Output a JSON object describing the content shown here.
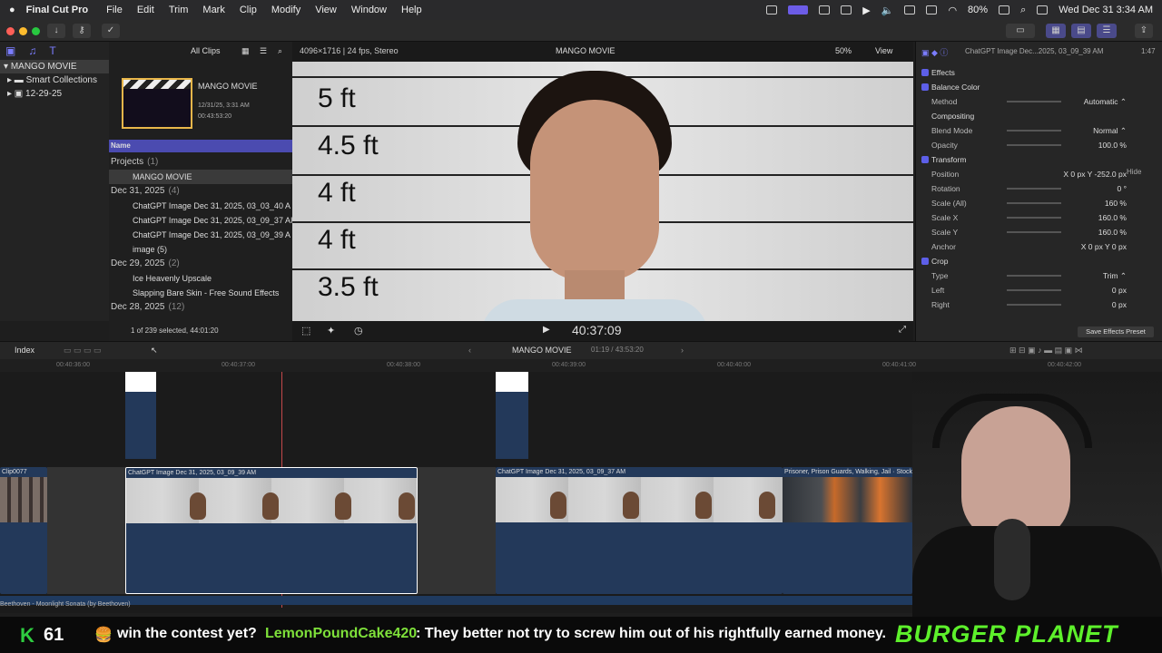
{
  "menubar": {
    "app": "Final Cut Pro",
    "items": [
      "File",
      "Edit",
      "Trim",
      "Mark",
      "Clip",
      "Modify",
      "View",
      "Window",
      "Help"
    ],
    "battery": "80%",
    "datetime": "Wed Dec 31  3:34 AM"
  },
  "library": {
    "name": "MANGO MOVIE",
    "items": [
      "Smart Collections",
      "12-29-25"
    ]
  },
  "browser": {
    "filter": "All Clips",
    "project_name": "MANGO MOVIE",
    "project_date": "12/31/25, 3:31 AM",
    "project_duration": "00:43:53:20",
    "column": "Name",
    "status": "1 of 239 selected, 44:01:20",
    "rows": [
      {
        "t": "Projects",
        "c": "(1)",
        "kind": "group"
      },
      {
        "t": "MANGO MOVIE",
        "c": "",
        "kind": "sel"
      },
      {
        "t": "Dec 31, 2025",
        "c": "(4)",
        "kind": "group"
      },
      {
        "t": "ChatGPT Image Dec 31, 2025, 03_03_40 A",
        "c": "",
        "kind": "item"
      },
      {
        "t": "ChatGPT Image Dec 31, 2025, 03_09_37 AI",
        "c": "",
        "kind": "item"
      },
      {
        "t": "ChatGPT Image Dec 31, 2025, 03_09_39 A",
        "c": "",
        "kind": "item"
      },
      {
        "t": "image (5)",
        "c": "",
        "kind": "item"
      },
      {
        "t": "Dec 29, 2025",
        "c": "(2)",
        "kind": "group"
      },
      {
        "t": "Ice Heavenly Upscale",
        "c": "",
        "kind": "item"
      },
      {
        "t": "Slapping Bare Skin - Free Sound Effects",
        "c": "",
        "kind": "item"
      },
      {
        "t": "Dec 28, 2025",
        "c": "(12)",
        "kind": "group"
      }
    ]
  },
  "viewer": {
    "format": "4096×1716 | 24 fps, Stereo",
    "title": "MANGO MOVIE",
    "zoom": "50%",
    "view": "View",
    "timecode": "40:37:09",
    "heights": [
      "5 ft",
      "4.5 ft",
      "4 ft",
      "4 ft",
      "3.5 ft"
    ]
  },
  "inspector": {
    "clip": "ChatGPT Image Dec...2025, 03_09_39 AM",
    "duration": "1:47",
    "rows": [
      {
        "l": "Effects",
        "v": "",
        "kind": "sec"
      },
      {
        "l": "Balance Color",
        "v": "",
        "kind": "chk"
      },
      {
        "l": "Method",
        "v": "Automatic ⌃",
        "kind": "row"
      },
      {
        "l": "Compositing",
        "v": "",
        "kind": "head"
      },
      {
        "l": "Blend Mode",
        "v": "Normal ⌃",
        "kind": "row"
      },
      {
        "l": "Opacity",
        "v": "100.0  %",
        "kind": "row"
      },
      {
        "l": "Transform",
        "v": "",
        "kind": "sec"
      },
      {
        "l": "Position",
        "v": "X   0  px   Y  -252.0  px",
        "kind": "row"
      },
      {
        "l": "Rotation",
        "v": "0  °",
        "kind": "row"
      },
      {
        "l": "Scale (All)",
        "v": "160  %",
        "kind": "row"
      },
      {
        "l": "Scale X",
        "v": "160.0  %",
        "kind": "row"
      },
      {
        "l": "Scale Y",
        "v": "160.0  %",
        "kind": "row"
      },
      {
        "l": "Anchor",
        "v": "X   0  px   Y   0  px",
        "kind": "row"
      },
      {
        "l": "Crop",
        "v": "",
        "kind": "sec"
      },
      {
        "l": "Type",
        "v": "Trim ⌃",
        "kind": "row"
      },
      {
        "l": "Left",
        "v": "0  px",
        "kind": "row"
      },
      {
        "l": "Right",
        "v": "0  px",
        "kind": "row"
      }
    ],
    "hide": "Hide",
    "save_preset": "Save Effects Preset"
  },
  "timeline": {
    "index": "Index",
    "project": "MANGO MOVIE",
    "position": "01:19 / 43:53:20",
    "ruler": [
      "00:40:36:00",
      "00:40:37:00",
      "00:40:38:00",
      "00:40:39:00",
      "00:40:40:00",
      "00:40:41:00",
      "00:40:42:00"
    ],
    "clips": [
      {
        "name": "Clip0077"
      },
      {
        "name": "ChatGPT Image Dec 31, 2025, 03_09_39 AM"
      },
      {
        "name": "ChatGPT Image Dec 31, 2025, 03_09_37 AM"
      },
      {
        "name": "Prisoner, Prison Guards, Walking, Jail · Stock Video"
      }
    ],
    "audio": "Beethoven - Moonlight Sonata (by Beethoven)"
  },
  "overlay": {
    "count": "61",
    "chat_prefix": "win the contest yet?",
    "chat_user": "LemonPoundCake420",
    "chat_msg": ": They better not try to screw him out of his rightfully earned money.",
    "brand": "BURGER PLANET"
  }
}
